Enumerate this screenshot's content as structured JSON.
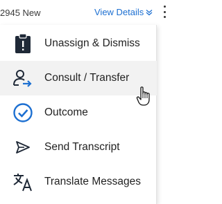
{
  "header": {
    "case_text": "2945 New",
    "view_details_label": "View Details"
  },
  "menu": {
    "items": [
      {
        "label": "Unassign & Dismiss",
        "icon": "clipboard-icon"
      },
      {
        "label": "Consult / Transfer",
        "icon": "user-transfer-icon"
      },
      {
        "label": "Outcome",
        "icon": "check-circle-icon"
      },
      {
        "label": "Send Transcript",
        "icon": "send-icon"
      },
      {
        "label": "Translate Messages",
        "icon": "translate-icon"
      }
    ],
    "hovered_item": "Consult / Transfer"
  },
  "colors": {
    "link": "#1c6fd1",
    "hover_bg": "#f2f2f2",
    "icon_dark": "#1f2937",
    "icon_blue": "#1c6fd1"
  }
}
